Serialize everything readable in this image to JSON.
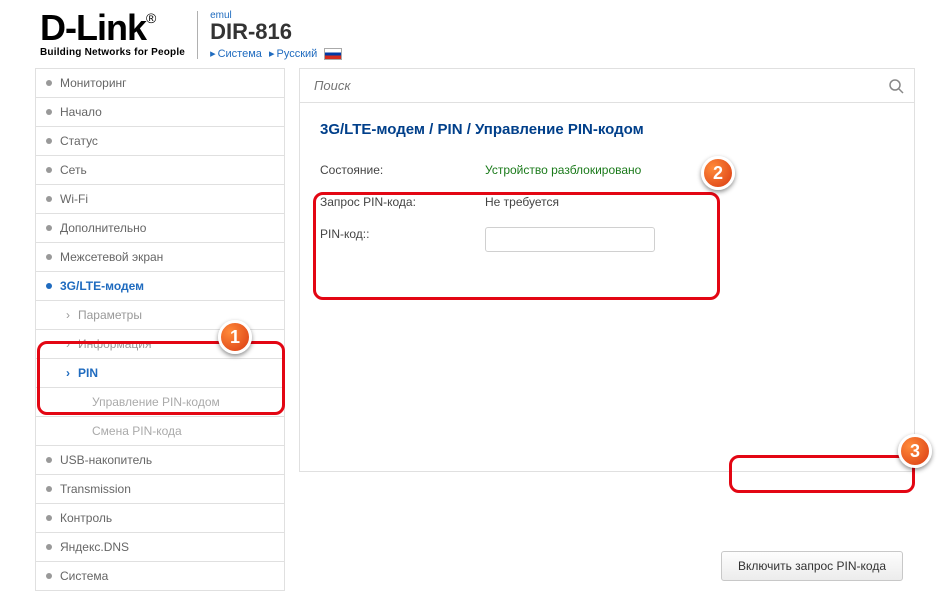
{
  "header": {
    "brand": "D-Link",
    "reg": "®",
    "tag": "Building Networks for People",
    "emul": "emul",
    "model": "DIR-816",
    "link_system": "Система",
    "link_lang": "Русский"
  },
  "nav": {
    "monitoring": "Мониторинг",
    "start": "Начало",
    "status": "Статус",
    "network": "Сеть",
    "wifi": "Wi-Fi",
    "extra": "Дополнительно",
    "firewall": "Межсетевой экран",
    "modem": "3G/LTE-модем",
    "modem_params": "Параметры",
    "modem_info": "Информация",
    "modem_pin": "PIN",
    "modem_pin_manage": "Управление PIN-кодом",
    "modem_pin_change": "Смена PIN-кода",
    "usb": "USB-накопитель",
    "transmission": "Transmission",
    "control": "Контроль",
    "yandex": "Яндекс.DNS",
    "system": "Система"
  },
  "search": {
    "placeholder": "Поиск"
  },
  "breadcrumb": "3G/LTE-модем /  PIN /  Управление PIN-кодом",
  "form": {
    "state_label": "Состояние:",
    "state_value": "Устройство разблокировано",
    "request_label": "Запрос PIN-кода:",
    "request_value": "Не требуется",
    "pin_label": "PIN-код::"
  },
  "button": {
    "enable_pin": "Включить запрос PIN-кода"
  },
  "callouts": {
    "c1": "1",
    "c2": "2",
    "c3": "3"
  }
}
